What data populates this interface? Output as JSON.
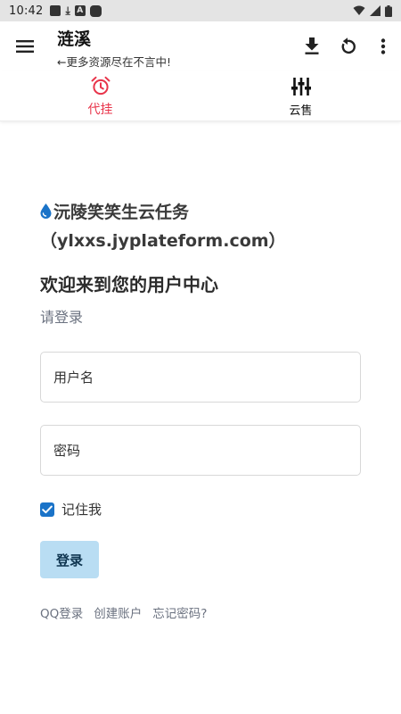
{
  "status_bar": {
    "time": "10:42"
  },
  "app_bar": {
    "title": "涟溪",
    "subtitle": "←更多资源尽在不言中!"
  },
  "tabs": [
    {
      "label": "代挂",
      "icon": "alarm-clock-icon",
      "active": true
    },
    {
      "label": "云售",
      "icon": "sliders-icon",
      "active": false
    }
  ],
  "login": {
    "site_title": "沅陵笑笑生云任务（ylxxs.jyplateform.com）",
    "welcome": "欢迎来到您的用户中心",
    "prompt": "请登录",
    "username_placeholder": "用户名",
    "password_placeholder": "密码",
    "remember_label": "记住我",
    "remember_checked": true,
    "login_button": "登录",
    "links": [
      "QQ登录",
      "创建账户",
      "忘记密码?"
    ]
  },
  "colors": {
    "accent_red": "#e8354b",
    "checkbox_blue": "#1a73c8",
    "login_button_bg": "#b9ddf3",
    "status_bar_bg": "#e4e4e4"
  }
}
